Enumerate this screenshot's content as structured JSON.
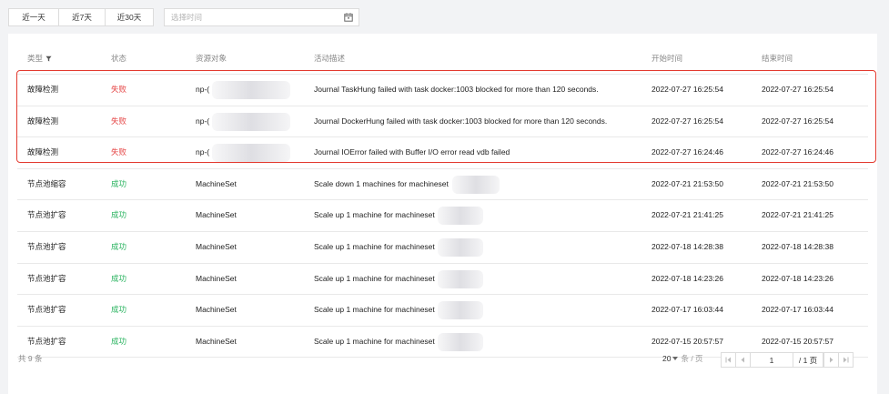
{
  "filters": {
    "ranges": [
      "近一天",
      "近7天",
      "近30天"
    ],
    "date_placeholder": "选择时间",
    "date_icon": "calendar-icon"
  },
  "table": {
    "headers": [
      "类型",
      "状态",
      "资源对象",
      "活动描述",
      "开始时间",
      "结束时间"
    ],
    "type_filter_icon": "filter-icon",
    "rows": [
      [
        "故障检测",
        "失败",
        "np-(",
        "Journal TaskHung failed with task docker:1003 blocked for more than 120 seconds.",
        "2022-07-27 16:25:54",
        "2022-07-27 16:25:54"
      ],
      [
        "故障检测",
        "失败",
        "np-(",
        "Journal DockerHung failed with task docker:1003 blocked for more than 120 seconds.",
        "2022-07-27 16:25:54",
        "2022-07-27 16:25:54"
      ],
      [
        "故障检测",
        "失败",
        "np-(",
        "Journal IOError failed with Buffer I/O error read vdb failed",
        "2022-07-27 16:24:46",
        "2022-07-27 16:24:46"
      ],
      [
        "节点池缩容",
        "成功",
        "MachineSet",
        "Scale down 1 machines for machineset",
        "2022-07-21 21:53:50",
        "2022-07-21 21:53:50"
      ],
      [
        "节点池扩容",
        "成功",
        "MachineSet",
        "Scale up 1 machine for machineset",
        "2022-07-21 21:41:25",
        "2022-07-21 21:41:25"
      ],
      [
        "节点池扩容",
        "成功",
        "MachineSet",
        "Scale up 1 machine for machineset",
        "2022-07-18 14:28:38",
        "2022-07-18 14:28:38"
      ],
      [
        "节点池扩容",
        "成功",
        "MachineSet",
        "Scale up 1 machine for machineset",
        "2022-07-18 14:23:26",
        "2022-07-18 14:23:26"
      ],
      [
        "节点池扩容",
        "成功",
        "MachineSet",
        "Scale up 1 machine for machineset",
        "2022-07-17 16:03:44",
        "2022-07-17 16:03:44"
      ],
      [
        "节点池扩容",
        "成功",
        "MachineSet",
        "Scale up 1 machine for machineset",
        "2022-07-15 20:57:57",
        "2022-07-15 20:57:57"
      ]
    ]
  },
  "pagination": {
    "total_label": "共 9 条",
    "page_size": "20",
    "page_size_unit": "条 / 页",
    "current_page": "1",
    "total_pages": "/ 1 页",
    "first_icon": "first-page-icon",
    "prev_icon": "prev-page-icon",
    "next_icon": "next-page-icon",
    "last_icon": "last-page-icon"
  },
  "colors": {
    "fail": "#e54545",
    "success": "#29b35f",
    "highlight": "#e33a2f"
  }
}
